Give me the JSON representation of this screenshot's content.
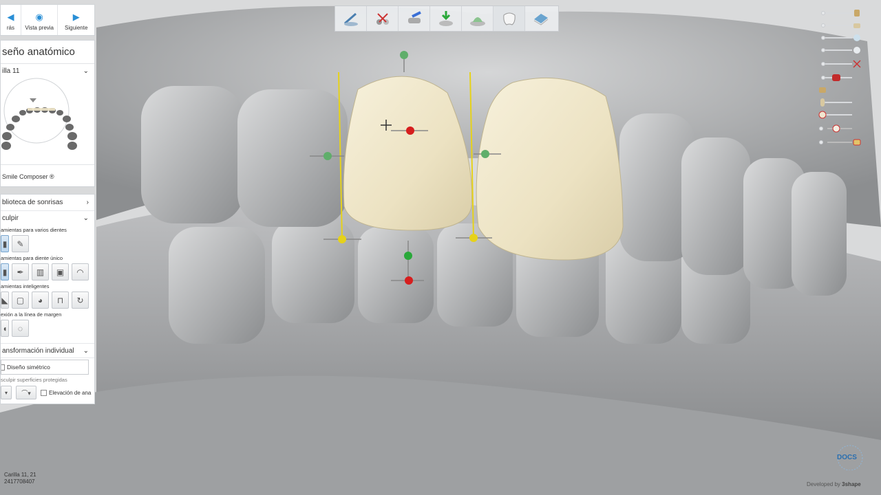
{
  "app": {
    "nav": {
      "back_label": "rás",
      "preview_label": "Vista previa",
      "next_label": "Siguiente"
    },
    "design_title": "seño anatómico",
    "tooth_selector": "illa 11",
    "smile_composer_label": "Smile Composer ®",
    "smile_library_label": "blioteca de sonrisas",
    "sculpt_section": {
      "title": "culpir",
      "multi_tools_label": "amientas para varios dientes",
      "single_tools_label": "amientas para diente único",
      "smart_tools_label": "amientas inteligentes",
      "margin_tools_label": "exión a la línea de margen"
    },
    "transform_section": {
      "title": "ansformación individual",
      "symmetric_label": "Diseño simétrico",
      "protected_label": "sculpir superficies protegidas",
      "elevation_label": "Elevación de ana"
    },
    "status": {
      "line1": "Carilla 11, 21",
      "line2": "2417708407"
    },
    "branding": {
      "docs_label": "DOCS",
      "developed_by": "Developed by",
      "company": "3shape"
    },
    "colors": {
      "accent": "#2a8fd6",
      "veneer": "#efe6c8",
      "scan_gray": "#a6a8aa",
      "handle_green": "#2aa83a",
      "handle_red": "#d61e1e",
      "handle_yellow": "#e6d21a"
    },
    "icons": {
      "toolbar": [
        "margin-line-icon",
        "cut-icon",
        "insertion-direction-icon",
        "download-model-icon",
        "die-model-icon",
        "tooth-icon",
        "scan-layer-icon"
      ],
      "sliders": [
        "crown-layer-icon",
        "jaw-layer-icon",
        "tooth-layer-icon",
        "tooth-layer-icon",
        "scissors-icon",
        "gingiva-icon",
        "implant-icon",
        "tooth-icon",
        "tooth-icon",
        "tooth-icon"
      ]
    }
  }
}
